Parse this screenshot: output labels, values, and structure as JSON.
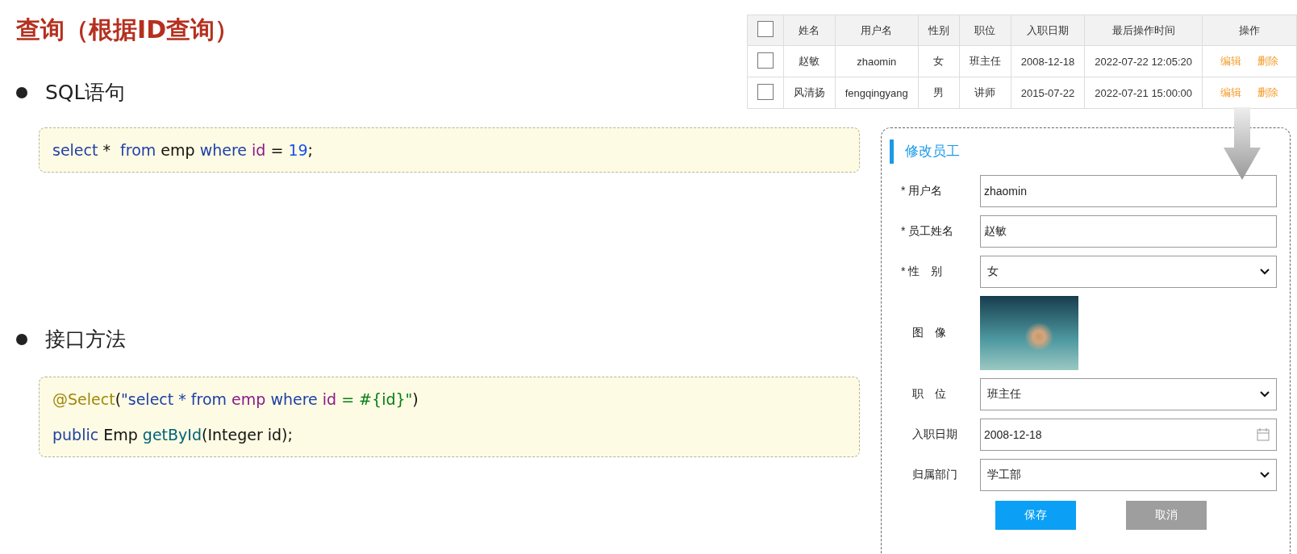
{
  "slide": {
    "title": "查询（根据ID查询）"
  },
  "sections": [
    {
      "bullet": "SQL语句",
      "code": [
        [
          {
            "kind": "keyword",
            "text": "select"
          },
          {
            "kind": "plain",
            "text": " *  "
          },
          {
            "kind": "keyword",
            "text": "from"
          },
          {
            "kind": "plain",
            "text": " emp "
          },
          {
            "kind": "keyword",
            "text": "where"
          },
          {
            "kind": "field",
            "text": " id"
          },
          {
            "kind": "plain",
            "text": " = "
          },
          {
            "kind": "number",
            "text": "19"
          },
          {
            "kind": "plain",
            "text": ";"
          }
        ]
      ]
    },
    {
      "bullet": "接口方法",
      "code": [
        [
          {
            "kind": "annotation",
            "text": "@Select"
          },
          {
            "kind": "plain",
            "text": "("
          },
          {
            "kind": "string",
            "text": "\"select * from "
          },
          {
            "kind": "field",
            "text": "emp"
          },
          {
            "kind": "string",
            "text": " where "
          },
          {
            "kind": "field",
            "text": "id"
          },
          {
            "kind": "literal",
            "text": " = #{id}\""
          },
          {
            "kind": "plain",
            "text": ")"
          }
        ],
        [
          {
            "kind": "keyword",
            "text": "public"
          },
          {
            "kind": "plain",
            "text": " Emp "
          },
          {
            "kind": "method",
            "text": "getById"
          },
          {
            "kind": "plain",
            "text": "(Integer id);"
          }
        ]
      ]
    }
  ],
  "table": {
    "header_checked": false,
    "columns": [
      "姓名",
      "用户名",
      "性别",
      "职位",
      "入职日期",
      "最后操作时间",
      "操作"
    ],
    "rows": [
      {
        "checked": false,
        "cells": [
          "赵敏",
          "zhaomin",
          "女",
          "班主任",
          "2008-12-18",
          "2022-07-22 12:05:20"
        ],
        "actions": [
          "编辑",
          "删除"
        ]
      },
      {
        "checked": false,
        "cells": [
          "风清扬",
          "fengqingyang",
          "男",
          "讲师",
          "2015-07-22",
          "2022-07-21 15:00:00"
        ],
        "actions": [
          "编辑",
          "删除"
        ]
      }
    ]
  },
  "form": {
    "title": "修改员工",
    "fields": [
      {
        "kind": "text",
        "label": "* 用户名",
        "value": "zhaomin"
      },
      {
        "kind": "text",
        "label": "* 员工姓名",
        "value": "赵敏"
      },
      {
        "kind": "select",
        "label": "* 性　别",
        "value": "女"
      },
      {
        "kind": "image",
        "label": "图　像"
      },
      {
        "kind": "select",
        "label": "职　位",
        "value": "班主任"
      },
      {
        "kind": "date",
        "label": "入职日期",
        "value": "2008-12-18"
      },
      {
        "kind": "select",
        "label": "归属部门",
        "value": "学工部"
      }
    ],
    "buttons": [
      {
        "kind": "primary",
        "label": "保存"
      },
      {
        "kind": "secondary",
        "label": "取消"
      }
    ]
  }
}
